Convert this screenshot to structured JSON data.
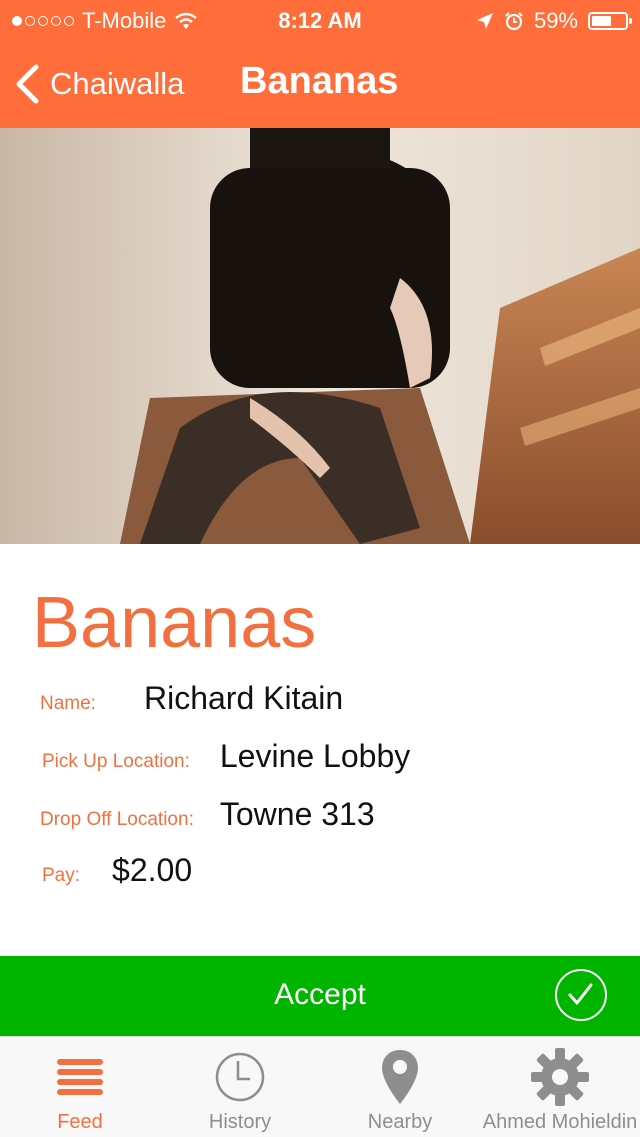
{
  "status_bar": {
    "carrier": "T-Mobile",
    "time": "8:12 AM",
    "battery": "59%",
    "battery_level": 0.59
  },
  "nav": {
    "back_label": "Chaiwalla",
    "title": "Bananas"
  },
  "item": {
    "title": "Bananas",
    "name_label": "Name:",
    "name_value": "Richard Kitain",
    "pickup_label": "Pick Up Location:",
    "pickup_value": "Levine Lobby",
    "dropoff_label": "Drop Off Location:",
    "dropoff_value": "Towne 313",
    "pay_label": "Pay:",
    "pay_value": "$2.00"
  },
  "accept_button": {
    "label": "Accept"
  },
  "tabs": [
    {
      "label": "Feed",
      "icon": "list-icon",
      "active": true
    },
    {
      "label": "History",
      "icon": "clock-icon",
      "active": false
    },
    {
      "label": "Nearby",
      "icon": "map-pin-icon",
      "active": false
    },
    {
      "label": "Ahmed Mohieldin",
      "icon": "gear-icon",
      "active": false
    }
  ],
  "colors": {
    "brand_orange": "#ff6e3a",
    "accept_green": "#00b400",
    "label_orange": "#f2703f"
  }
}
